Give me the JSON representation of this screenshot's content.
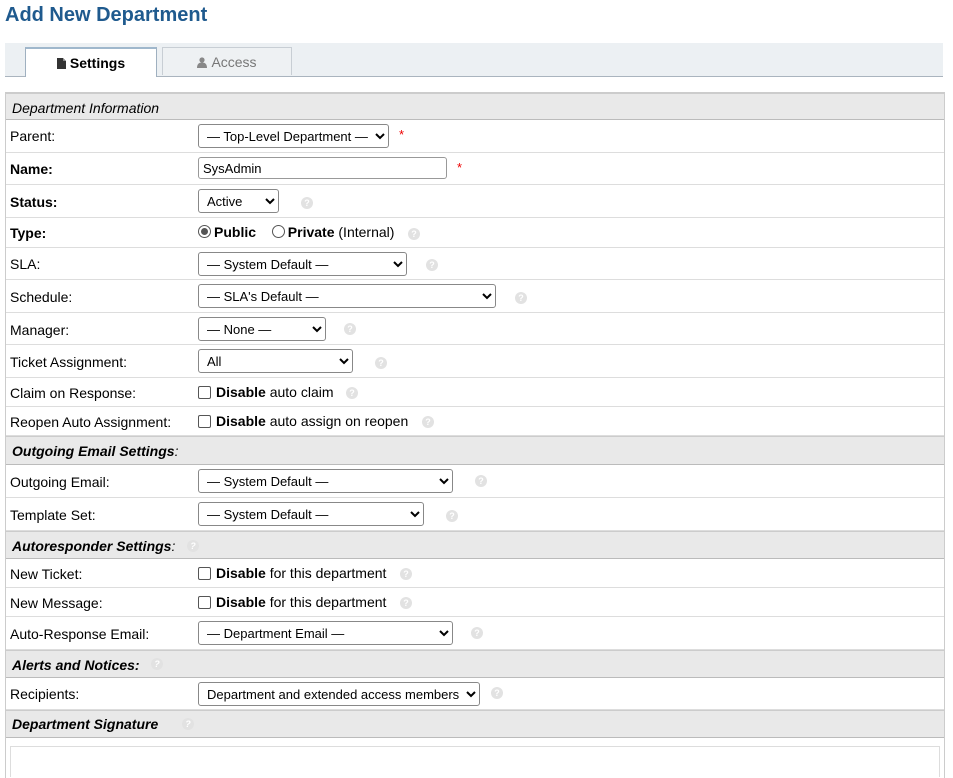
{
  "page": {
    "title": "Add New Department"
  },
  "tabs": [
    {
      "label": "Settings",
      "icon": "file-icon",
      "active": true
    },
    {
      "label": "Access",
      "icon": "user-icon",
      "active": false
    }
  ],
  "sections": {
    "dept_info": "Department Information",
    "outgoing": "Outgoing Email Settings",
    "autoresponder": "Autoresponder Settings",
    "alerts": "Alerts and Notices:",
    "signature": "Department Signature",
    "colon": ":"
  },
  "fields": {
    "parent": {
      "label": "Parent:",
      "value": "— Top-Level Department —"
    },
    "name": {
      "label": "Name:",
      "value": "SysAdmin"
    },
    "status": {
      "label": "Status:",
      "value": "Active"
    },
    "type": {
      "label": "Type:",
      "public": "Public",
      "private": "Private",
      "internal": "(Internal)"
    },
    "sla": {
      "label": "SLA:",
      "value": "— System Default —"
    },
    "schedule": {
      "label": "Schedule:",
      "value": "— SLA's Default —"
    },
    "manager": {
      "label": "Manager:",
      "value": "— None —"
    },
    "ticket_assignment": {
      "label": "Ticket Assignment:",
      "value": "All"
    },
    "claim": {
      "label": "Claim on Response:",
      "bold": "Disable",
      "rest": " auto claim"
    },
    "reopen": {
      "label": "Reopen Auto Assignment:",
      "bold": "Disable",
      "rest": " auto assign on reopen"
    },
    "outgoing_email": {
      "label": "Outgoing Email:",
      "value": "— System Default —"
    },
    "template_set": {
      "label": "Template Set:",
      "value": "— System Default —"
    },
    "new_ticket": {
      "label": "New Ticket:",
      "bold": "Disable",
      "rest": " for this department"
    },
    "new_message": {
      "label": "New Message:",
      "bold": "Disable",
      "rest": " for this department"
    },
    "auto_response_email": {
      "label": "Auto-Response Email:",
      "value": "— Department Email —"
    },
    "recipients": {
      "label": "Recipients:",
      "value": "Department and extended access members"
    }
  },
  "required_mark": "*",
  "help_glyph": "?",
  "colors": {
    "title": "#1f5a8e",
    "section_bg": "#e9e9e9",
    "required": "#e00000"
  }
}
